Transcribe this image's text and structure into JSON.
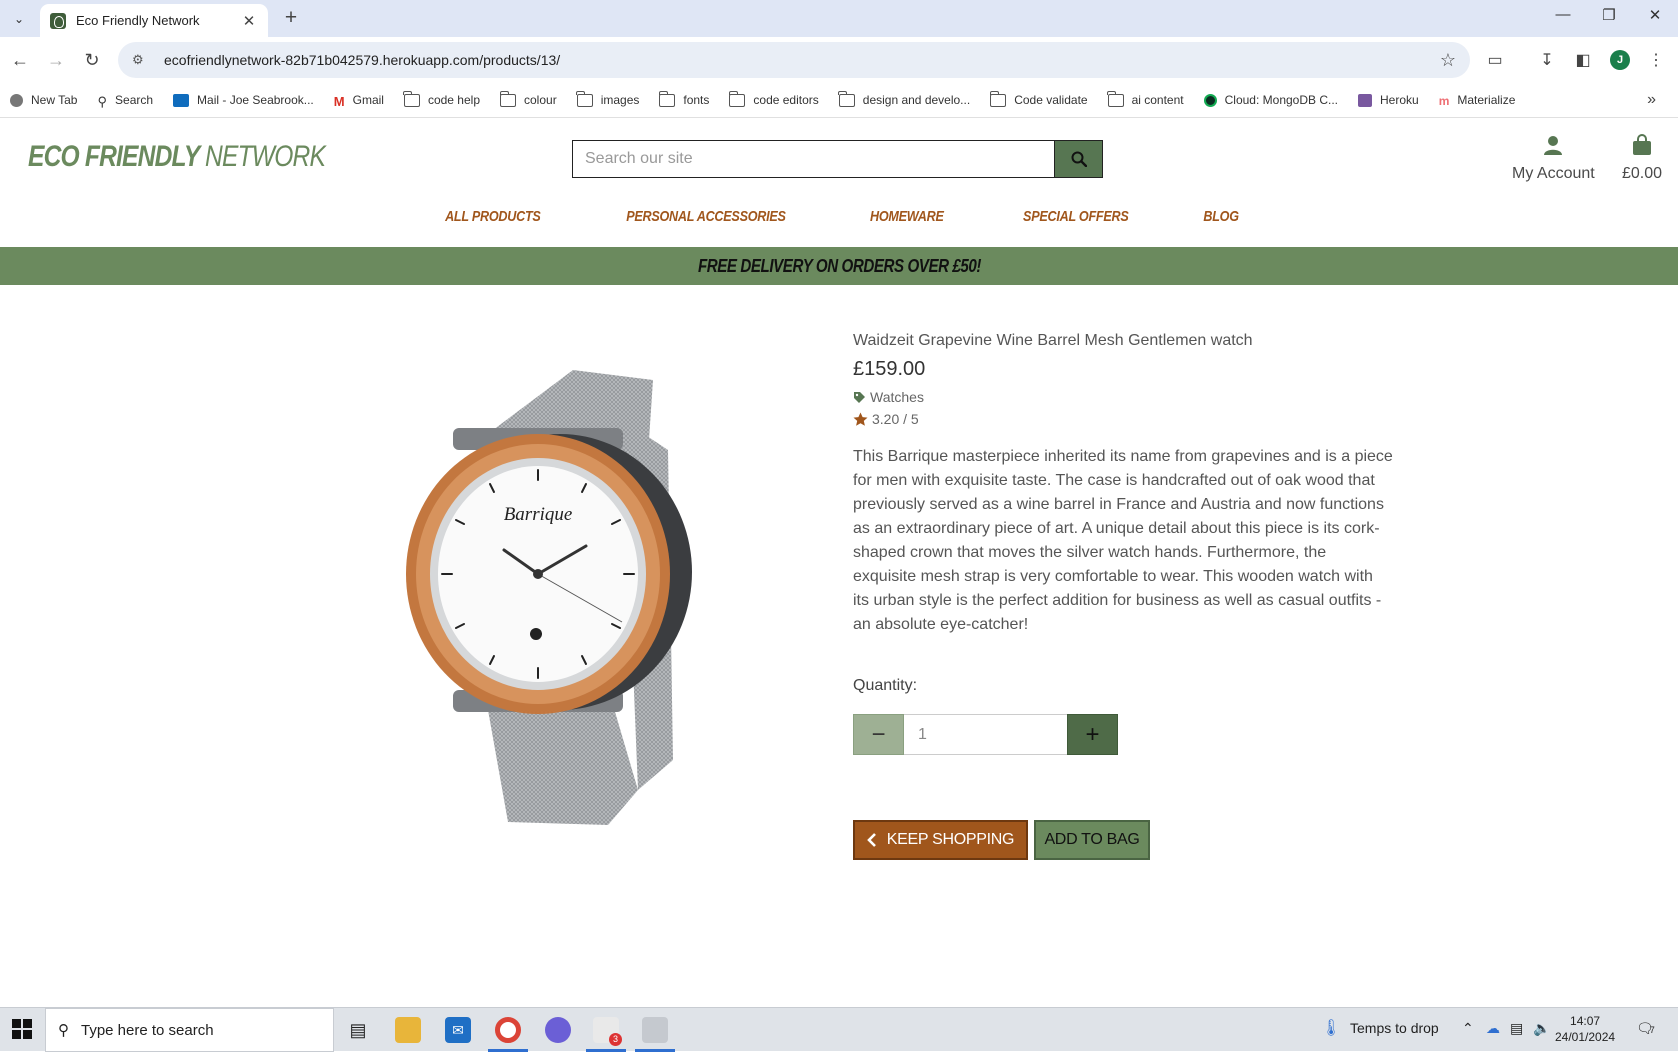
{
  "browser": {
    "tab_title": "Eco Friendly Network",
    "url": "ecofriendlynetwork-82b71b042579.herokuapp.com/products/13/",
    "profile_initial": "J",
    "bookmarks": [
      "New Tab",
      "Search",
      "Mail - Joe Seabrook...",
      "Gmail",
      "code help",
      "colour",
      "images",
      "fonts",
      "code editors",
      "design and develo...",
      "Code validate",
      "ai content",
      "Cloud: MongoDB C...",
      "Heroku",
      "Materialize"
    ]
  },
  "site": {
    "logo_bold": "ECO FRIENDLY",
    "logo_thin": "NETWORK",
    "search_placeholder": "Search our site",
    "account_label": "My Account",
    "bag_total": "£0.00",
    "nav": [
      "ALL PRODUCTS",
      "PERSONAL ACCESSORIES",
      "HOMEWARE",
      "SPECIAL OFFERS",
      "BLOG"
    ],
    "banner": "FREE DELIVERY ON ORDERS OVER £50!"
  },
  "product": {
    "name": "Waidzeit Grapevine Wine Barrel Mesh Gentlemen watch",
    "price": "£159.00",
    "category": "Watches",
    "rating": "3.20 / 5",
    "watch_brand": "Barrique",
    "description": "This Barrique masterpiece inherited its name from grapevines and is a piece for men with exquisite taste. The case is handcrafted out of oak wood that previously served as a wine barrel in France and Austria and now functions as an extraordinary piece of art. A unique detail about this piece is its cork-shaped crown that moves the silver watch hands. Furthermore, the exquisite mesh strap is very comfortable to wear. This wooden watch with its urban style is the perfect addition for business as well as casual outfits - an absolute eye-catcher!",
    "quantity_label": "Quantity:",
    "quantity_value": "1",
    "keep_shopping": "KEEP SHOPPING",
    "add_to_bag": "ADD TO BAG"
  },
  "taskbar": {
    "search_placeholder": "Type here to search",
    "weather": "Temps to drop",
    "time": "14:07",
    "date": "24/01/2024",
    "slack_badge": "3",
    "notification_count": "7"
  },
  "colors": {
    "brand_green": "#6b8a5e",
    "dark_green": "#577652",
    "brand_orange": "#a0561c"
  }
}
